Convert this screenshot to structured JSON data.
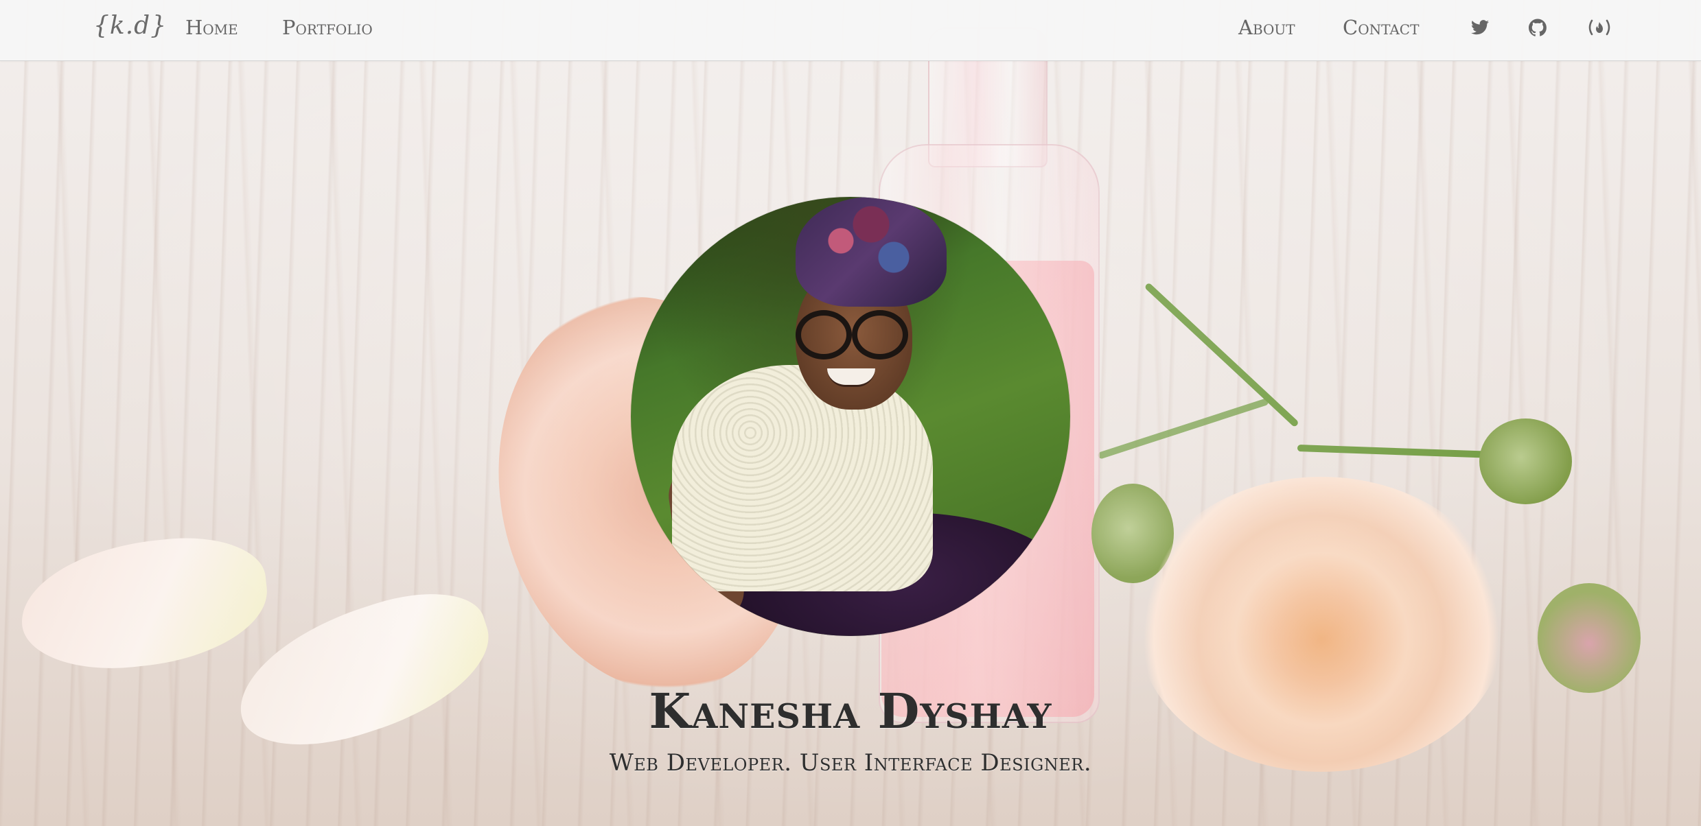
{
  "nav": {
    "logo_text": "{k.d}",
    "links": {
      "home": "Home",
      "portfolio": "Portfolio",
      "about": "About",
      "contact": "Contact"
    },
    "icons": [
      "twitter-icon",
      "github-icon",
      "freecodecamp-icon"
    ]
  },
  "hero": {
    "name": "Kanesha Dyshay",
    "tagline": "Web Developer. User Interface Designer.",
    "photo": "profile-photo"
  },
  "colors": {
    "navbar_bg": "#f6f6f6",
    "nav_text": "#666666",
    "heading_text": "#2e2e2e",
    "rose_peach": "#f4c29d",
    "liquid_pink": "#fcc3c6"
  }
}
